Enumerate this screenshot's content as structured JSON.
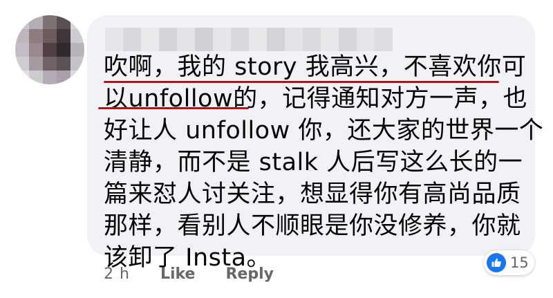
{
  "comment": {
    "lines": [
      "吹啊，我的 story 我高兴，不喜欢你可",
      "以unfollow的，记得通知对方一声，也",
      "好让人 unfollow 你，还大家的世界一个",
      "清静，而不是 stalk 人后写这么长的一",
      "篇来怼人讨关注，想显得你有高尚品质",
      "那样，看别人不顺眼是你没修养，你就",
      "该卸了 Insta。"
    ]
  },
  "footer": {
    "time": "2 h",
    "like_label": "Like",
    "reply_label": "Reply"
  },
  "reactions": {
    "count": "15",
    "icon": "thumbs-up-icon",
    "color": "#1877f2"
  },
  "colors": {
    "bubble": "#f0f2f5",
    "underline": "#e10000",
    "text": "#050505",
    "meta": "#65676b"
  }
}
